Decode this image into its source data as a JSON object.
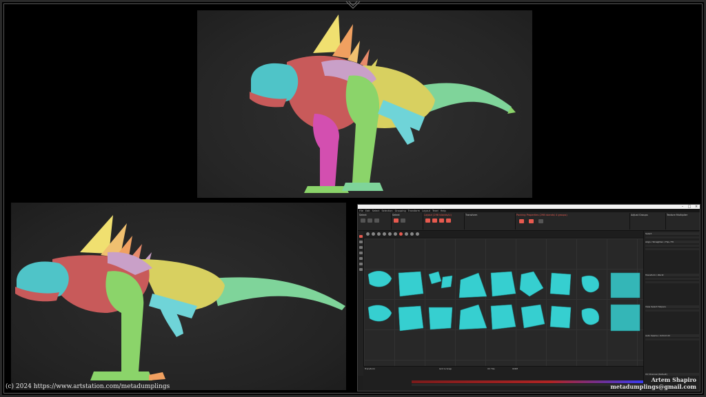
{
  "credit": "(c) 2024 https://www.artstation.com/metadumplings",
  "signature": {
    "name": "Artem Shapiro",
    "email": "metadumplings@gmail.com"
  },
  "colors": {
    "background": "#000000",
    "head": "#4fc4c8",
    "neck": "#c85a5a",
    "torso_mid": "#c9a0c8",
    "body_rear": "#d8d060",
    "tail": "#7fd49a",
    "legs_front": "#6fd4d8",
    "leg_pink": "#d34fb0",
    "leg_green": "#8bd46a",
    "spikes_yellow": "#f0e070",
    "spikes_orange": "#f0a060",
    "ui_accent": "#e85a4f",
    "uv_islands": "#36cfd0"
  },
  "app": {
    "menus": [
      "File",
      "Edit",
      "Select",
      "Selection",
      "Grouping",
      "Transform",
      "Layout",
      "Texel",
      "Help"
    ],
    "toolbar_headings": [
      "Select",
      "Select",
      "Transform",
      "Packing Properties",
      "Adjust Groups",
      "Texture Multiplier"
    ],
    "toolbar_heading_labels": [
      "Layout (298 islands/Li)",
      "Packing Properties (298 islands/ 4 groups)"
    ],
    "right_panel_sections": [
      "Select",
      "Align / Straighten / Flip / Fit",
      "Transform / World",
      "View Select Helpers",
      "Auto Seams / Unfold UV",
      "UV Channel (Default)"
    ],
    "bottom_headings": [
      "Transform",
      "Grid & Snap",
      "UV Tile",
      "UDIM"
    ]
  }
}
